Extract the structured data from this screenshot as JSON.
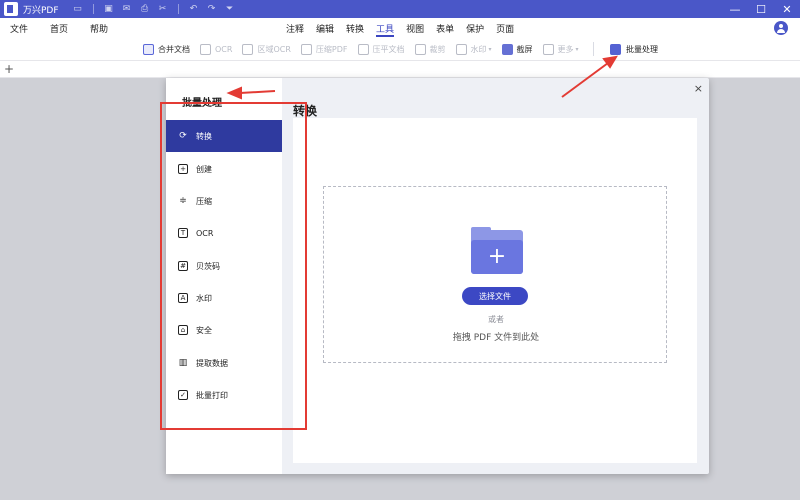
{
  "app": {
    "title": "万兴PDF"
  },
  "window_controls": {
    "minimize": "—",
    "maximize": "☐",
    "close": "✕"
  },
  "menu": {
    "items": [
      "文件",
      "首页",
      "帮助"
    ]
  },
  "tabs": [
    "注释",
    "编辑",
    "转换",
    "工具",
    "视图",
    "表单",
    "保护",
    "页面"
  ],
  "active_tab": "工具",
  "toolbar": {
    "items": [
      {
        "label": "合并文档",
        "icon": "merge-icon",
        "enabled": true
      },
      {
        "label": "OCR",
        "icon": "ocr-icon",
        "enabled": false
      },
      {
        "label": "区域OCR",
        "icon": "area-ocr-icon",
        "enabled": false
      },
      {
        "label": "压缩PDF",
        "icon": "compress-icon",
        "enabled": false
      },
      {
        "label": "压平文档",
        "icon": "flatten-icon",
        "enabled": false
      },
      {
        "label": "裁剪",
        "icon": "crop-icon",
        "enabled": false
      },
      {
        "label": "水印",
        "icon": "watermark-icon",
        "enabled": false
      },
      {
        "label": "截屏",
        "icon": "screenshot-icon",
        "enabled": true
      },
      {
        "label": "更多",
        "icon": "more-icon",
        "enabled": false
      }
    ],
    "batch_label": "批量处理"
  },
  "tabstrip": {
    "add": "+"
  },
  "dialog": {
    "side_title": "批量处理",
    "title": "转换",
    "close": "×",
    "side_items": [
      {
        "label": "转换",
        "icon": "convert-icon",
        "glyph": "⟳"
      },
      {
        "label": "创建",
        "icon": "create-icon",
        "glyph": "+"
      },
      {
        "label": "压缩",
        "icon": "compress-icon",
        "glyph": "≑"
      },
      {
        "label": "OCR",
        "icon": "ocr-icon",
        "glyph": "T"
      },
      {
        "label": "贝茨码",
        "icon": "bates-icon",
        "glyph": "#"
      },
      {
        "label": "水印",
        "icon": "watermark-icon",
        "glyph": "A"
      },
      {
        "label": "安全",
        "icon": "lock-icon",
        "glyph": "⌂"
      },
      {
        "label": "提取数据",
        "icon": "extract-data-icon",
        "glyph": "▥"
      },
      {
        "label": "批量打印",
        "icon": "print-icon",
        "glyph": "✓"
      }
    ],
    "active_item": "转换",
    "select_button": "选择文件",
    "or_text": "或者",
    "drag_text": "拖拽 PDF 文件到此处"
  },
  "colors": {
    "brand": "#4a57c8",
    "active": "#2f3a9f",
    "annotation": "#e33b34"
  }
}
